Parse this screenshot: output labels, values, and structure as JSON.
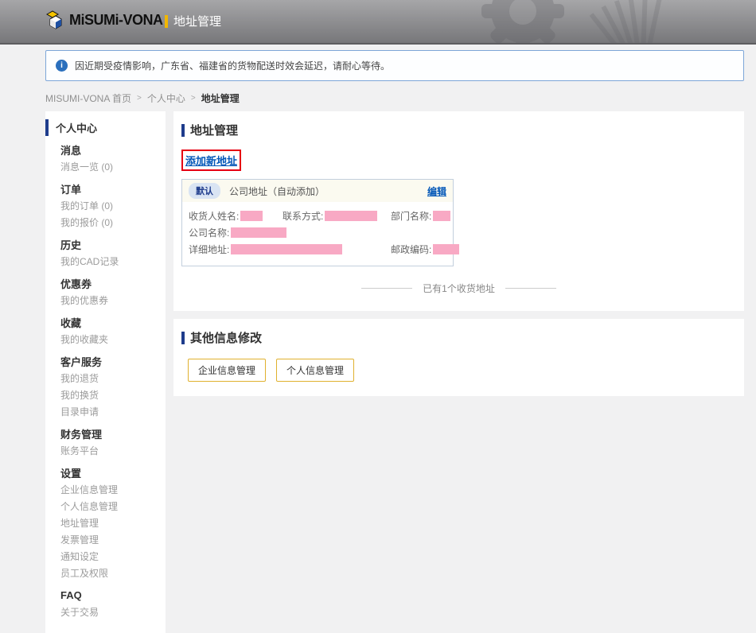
{
  "header": {
    "logo_text": "MiSUMi-VONA",
    "page_title": "地址管理"
  },
  "notice": {
    "text": "因近期受疫情影响，广东省、福建省的货物配送时效会延迟，请耐心等待。"
  },
  "breadcrumb": {
    "items": [
      "MISUMI-VONA 首页",
      "个人中心",
      "地址管理"
    ],
    "separator": ">"
  },
  "sidebar": {
    "title": "个人中心",
    "sections": [
      {
        "header": "消息",
        "items": [
          "消息一览 (0)"
        ]
      },
      {
        "header": "订单",
        "items": [
          "我的订单 (0)",
          "我的报价 (0)"
        ]
      },
      {
        "header": "历史",
        "items": [
          "我的CAD记录"
        ]
      },
      {
        "header": "优惠券",
        "items": [
          "我的优惠券"
        ]
      },
      {
        "header": "收藏",
        "items": [
          "我的收藏夹"
        ]
      },
      {
        "header": "客户服务",
        "items": [
          "我的退货",
          "我的换货",
          "目录申请"
        ]
      },
      {
        "header": "财务管理",
        "items": [
          "账务平台"
        ]
      },
      {
        "header": "设置",
        "items": [
          "企业信息管理",
          "个人信息管理",
          "地址管理",
          "发票管理",
          "通知设定",
          "员工及权限"
        ]
      },
      {
        "header": "FAQ",
        "items": [
          "关于交易"
        ]
      }
    ]
  },
  "main": {
    "address_section": {
      "title": "地址管理",
      "add_link": "添加新地址",
      "card": {
        "badge": "默认",
        "type_label": "公司地址（自动添加）",
        "edit_link": "编辑",
        "fields": {
          "recipient": "收货人姓名:",
          "contact": "联系方式:",
          "department": "部门名称:",
          "company": "公司名称:",
          "address": "详细地址:",
          "postal": "邮政编码:"
        }
      },
      "footer_note": "已有1个收货地址"
    },
    "other_section": {
      "title": "其他信息修改",
      "buttons": [
        "企业信息管理",
        "个人信息管理"
      ]
    }
  },
  "colors": {
    "accent_navy": "#1e3c8c",
    "link_blue": "#0257b8",
    "annotation_red": "#e60012",
    "redaction_pink": "#f8a9c4",
    "button_gold_border": "#e0b12f",
    "notice_border": "#7da6d8",
    "title_bar_yellow": "#f2b700",
    "header_gradient_top": "#a6a6a8",
    "header_gradient_bottom": "#77777a",
    "page_background": "#f1f1f2"
  }
}
